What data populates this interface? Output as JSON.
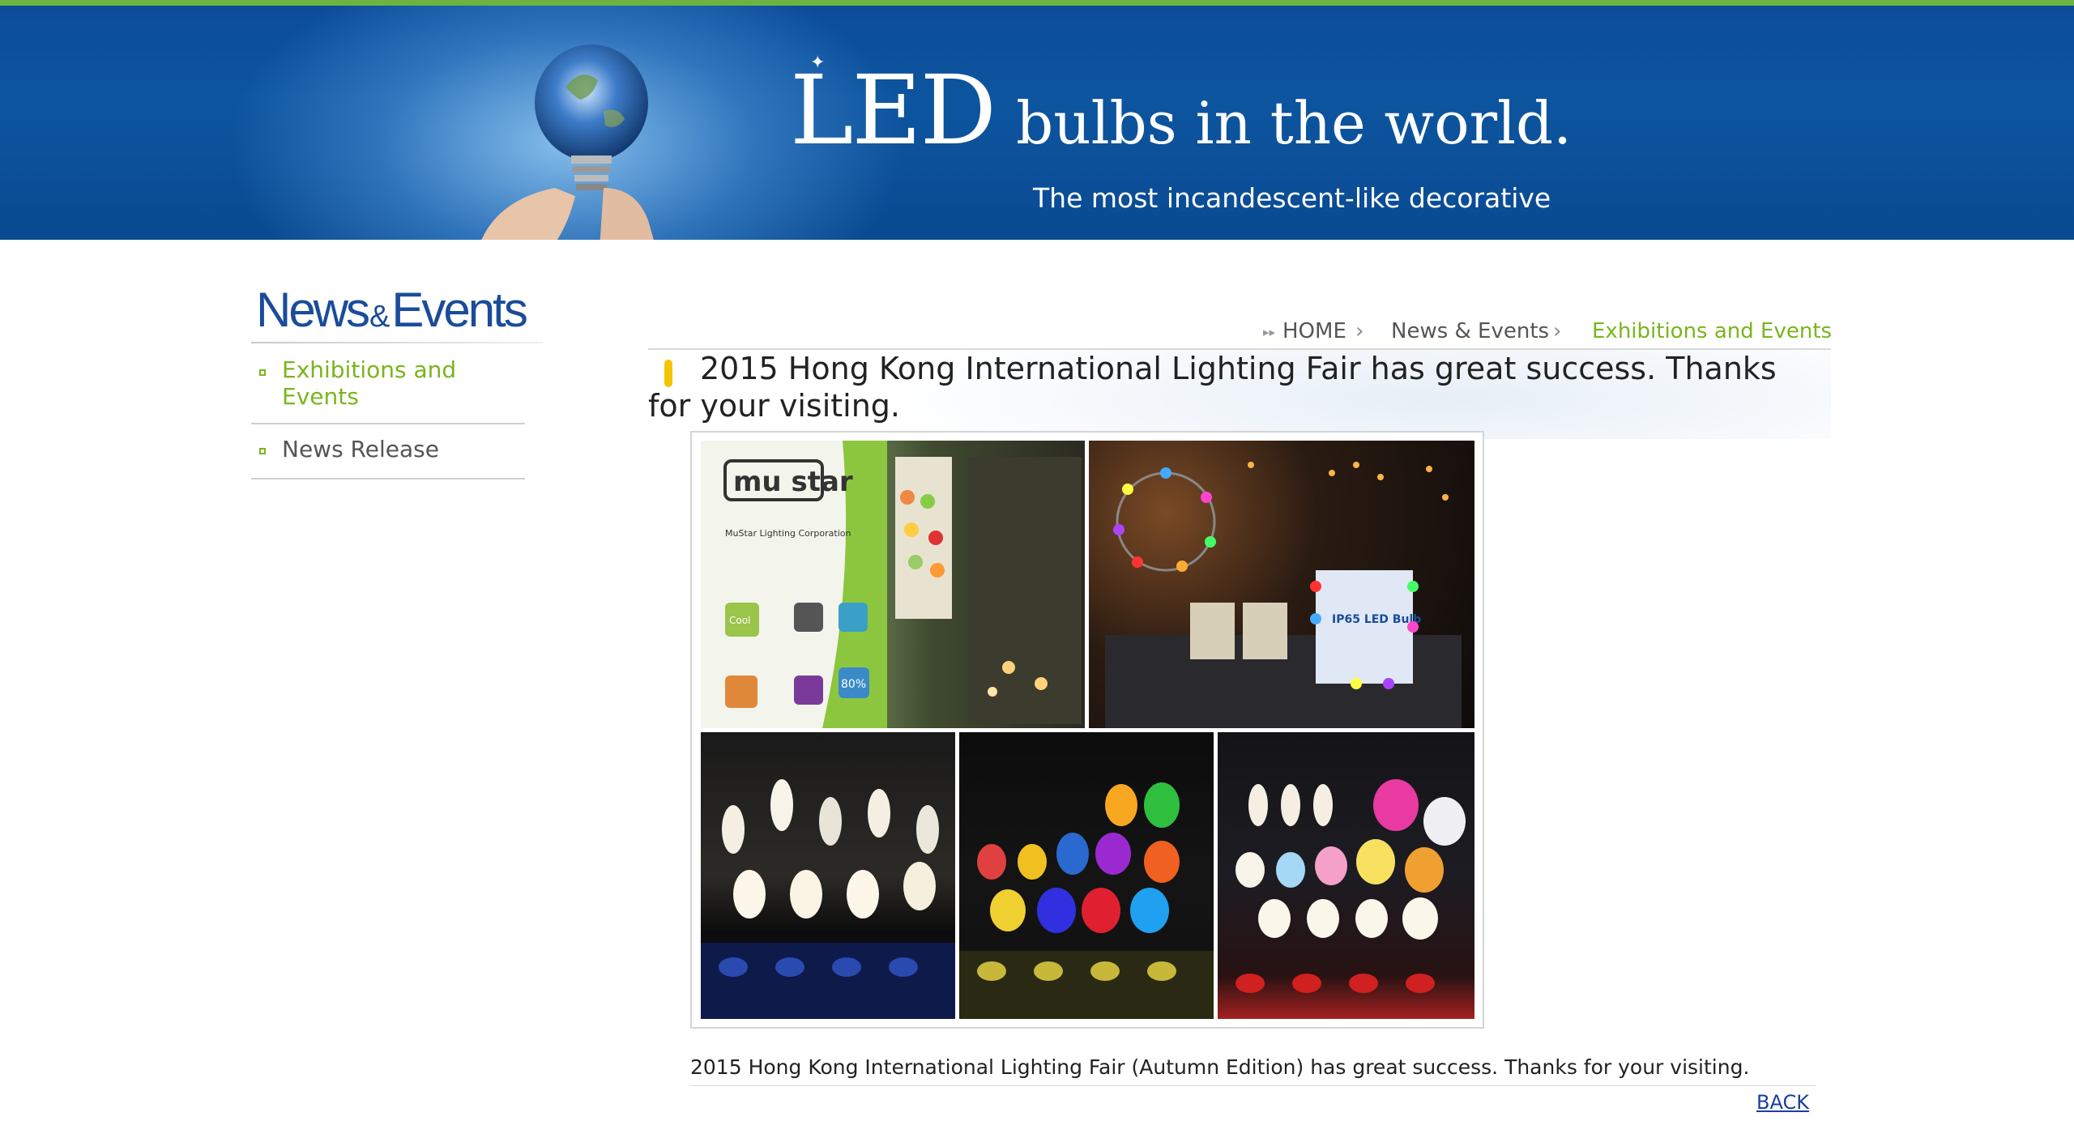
{
  "banner": {
    "title_big": "LED",
    "title_rest": "bulbs in the world.",
    "subtitle": "The most incandescent-like decorative",
    "bulb_icon": "globe-lightbulb-icon",
    "accent_color": "#6cb33f",
    "background_color": "#0b4c9a"
  },
  "sidebar": {
    "title_part1": "News",
    "title_amp": "&",
    "title_part2": "Events",
    "items": [
      {
        "label": "Exhibitions and Events",
        "active": true
      },
      {
        "label": "News Release",
        "active": false
      }
    ]
  },
  "breadcrumb": {
    "home": "HOME",
    "separator": "›",
    "section": "News & Events",
    "current": "Exhibitions and Events"
  },
  "article": {
    "headline": "2015 Hong Kong International Lighting Fair has great success. Thanks for your visiting.",
    "photo_brand": "mu star",
    "photo_brand_sub": "MuStar Lighting Corporation",
    "photo_badge_1": "Cool",
    "photo_badge_2": "80%",
    "photo_sign": "IP65 LED Bulb",
    "caption": "2015 Hong Kong International Lighting Fair (Autumn Edition) has great success. Thanks for your visiting.",
    "back_label": "BACK"
  },
  "colors": {
    "active_green": "#7ab51d",
    "headline_marker": "#f5c400",
    "sidebar_title": "#1a4c9a",
    "link_blue": "#1a3fa0"
  }
}
